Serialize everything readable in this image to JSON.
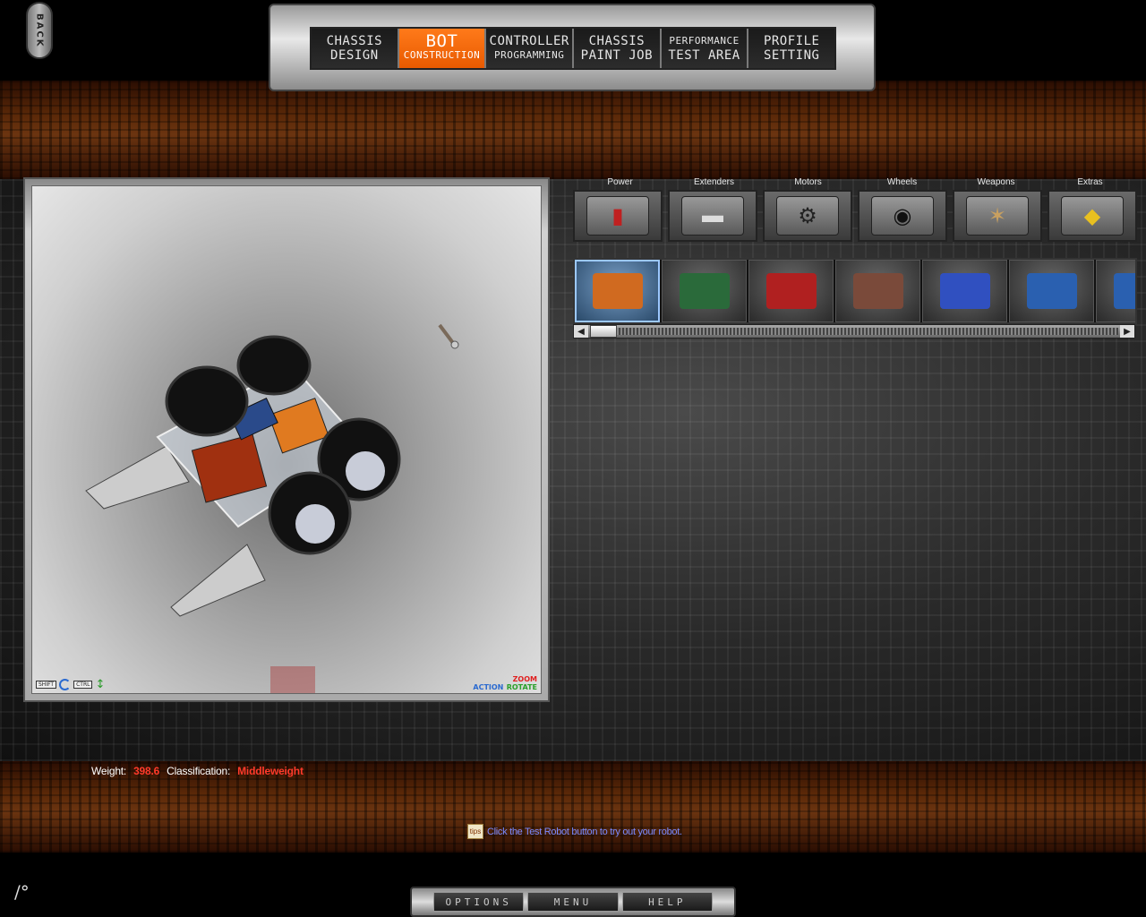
{
  "back": {
    "label": "BACK"
  },
  "nav": {
    "tabs": [
      {
        "line1": "CHASSIS",
        "line2": "DESIGN",
        "active": false
      },
      {
        "line1": "BOT",
        "line2": "CONSTRUCTION",
        "active": true
      },
      {
        "line1": "CONTROLLER",
        "line2": "PROGRAMMING",
        "active": false
      },
      {
        "line1": "CHASSIS",
        "line2": "PAINT JOB",
        "active": false
      },
      {
        "line1": "PERFORMANCE",
        "line2": "TEST AREA",
        "active": false
      },
      {
        "line1": "PROFILE",
        "line2": "SETTING",
        "active": false
      }
    ]
  },
  "viewport": {
    "shift_key": "SHIFT",
    "ctrl_key": "CTRL",
    "zoom_label": "ZOOM",
    "action_label": "ACTION",
    "rotate_label": "ROTATE"
  },
  "categories": {
    "labels": [
      "Power",
      "Extenders",
      "Motors",
      "Wheels",
      "Weapons",
      "Extras"
    ],
    "icons": [
      "battery-icon",
      "extender-bar-icon",
      "motor-icon",
      "wheel-icon",
      "weapon-icon",
      "extras-icon"
    ]
  },
  "parts": {
    "items": [
      {
        "icon": "orange-battery-pack-icon",
        "color": "#d06a20",
        "selected": true
      },
      {
        "icon": "circuit-board-icon",
        "color": "#2a6a3a",
        "selected": false
      },
      {
        "icon": "red-battery-icon",
        "color": "#b02020",
        "selected": false
      },
      {
        "icon": "multi-battery-icon",
        "color": "#7a4a3a",
        "selected": false
      },
      {
        "icon": "puma-battery-icon",
        "color": "#3050c0",
        "selected": false
      },
      {
        "icon": "blue-battery-icon",
        "color": "#2a60b0",
        "selected": false
      },
      {
        "icon": "blue-battery-icon",
        "color": "#2a60b0",
        "selected": false
      }
    ]
  },
  "stats": {
    "weight_label": "Weight:",
    "weight_value": "398.6",
    "class_label": "Classification:",
    "class_value": "Middleweight"
  },
  "tip": {
    "icon_label": "tips",
    "text": "Click the Test Robot button to try out your robot."
  },
  "bottom_menu": {
    "options": "OPTIONS",
    "menu": "MENU",
    "help": "HELP"
  },
  "colors": {
    "accent": "#ff6a10",
    "stat_value": "#ff3a2a",
    "tip_text": "#7a8aff"
  }
}
